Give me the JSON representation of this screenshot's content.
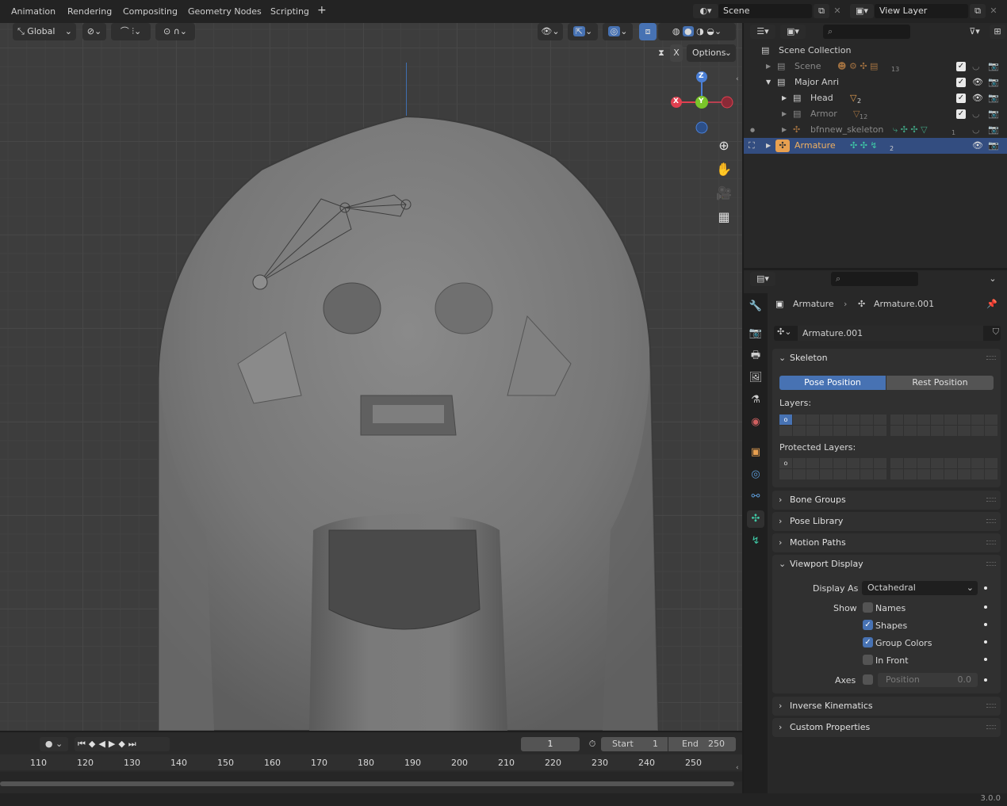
{
  "topbar": {
    "workspace_tabs": [
      "Animation",
      "Rendering",
      "Compositing",
      "Geometry Nodes",
      "Scripting"
    ],
    "add_tab": "+",
    "scene_field": "Scene",
    "view_layer_field": "View Layer"
  },
  "viewport": {
    "transform_orientation": "Global",
    "options_label": "Options",
    "x_button": "X",
    "gizmo": {
      "z": "Z",
      "y": "Y",
      "x": "X"
    }
  },
  "timeline": {
    "current_frame": "1",
    "start_label": "Start",
    "start_value": "1",
    "end_label": "End",
    "end_value": "250",
    "ticks": [
      "110",
      "120",
      "130",
      "140",
      "150",
      "160",
      "170",
      "180",
      "190",
      "200",
      "210",
      "220",
      "230",
      "240",
      "250"
    ]
  },
  "outliner": {
    "scene_collection": "Scene Collection",
    "rows": [
      {
        "name": "Scene",
        "badge": "13"
      },
      {
        "name": "Major Anri"
      },
      {
        "name": "Head",
        "badge": "2"
      },
      {
        "name": "Armor",
        "badge": "12"
      },
      {
        "name": "bfnnew_skeleton",
        "badge": "1"
      },
      {
        "name": "Armature",
        "badge": "2"
      }
    ]
  },
  "properties": {
    "breadcrumb_object": "Armature",
    "breadcrumb_data": "Armature.001",
    "datablock_name": "Armature.001",
    "skeleton": {
      "title": "Skeleton",
      "pose_position": "Pose Position",
      "rest_position": "Rest Position",
      "layers_label": "Layers:",
      "protected_layers_label": "Protected Layers:"
    },
    "collapsed_panels": [
      "Bone Groups",
      "Pose Library",
      "Motion Paths"
    ],
    "viewport_display": {
      "title": "Viewport Display",
      "display_as_label": "Display As",
      "display_as_value": "Octahedral",
      "show_label": "Show",
      "names": "Names",
      "shapes": "Shapes",
      "group_colors": "Group Colors",
      "in_front": "In Front",
      "axes_label": "Axes",
      "position_label": "Position",
      "position_value": "0.0",
      "checks": {
        "names": false,
        "shapes": true,
        "group_colors": true,
        "in_front": false,
        "axes": false
      }
    },
    "bottom_panels": [
      "Inverse Kinematics",
      "Custom Properties"
    ]
  },
  "status": {
    "version": "3.0.0"
  },
  "colors": {
    "accent": "#4772b3",
    "selected_row": "#334d80",
    "object_orange": "#e8a050",
    "armature_teal": "#3fc9a6"
  }
}
